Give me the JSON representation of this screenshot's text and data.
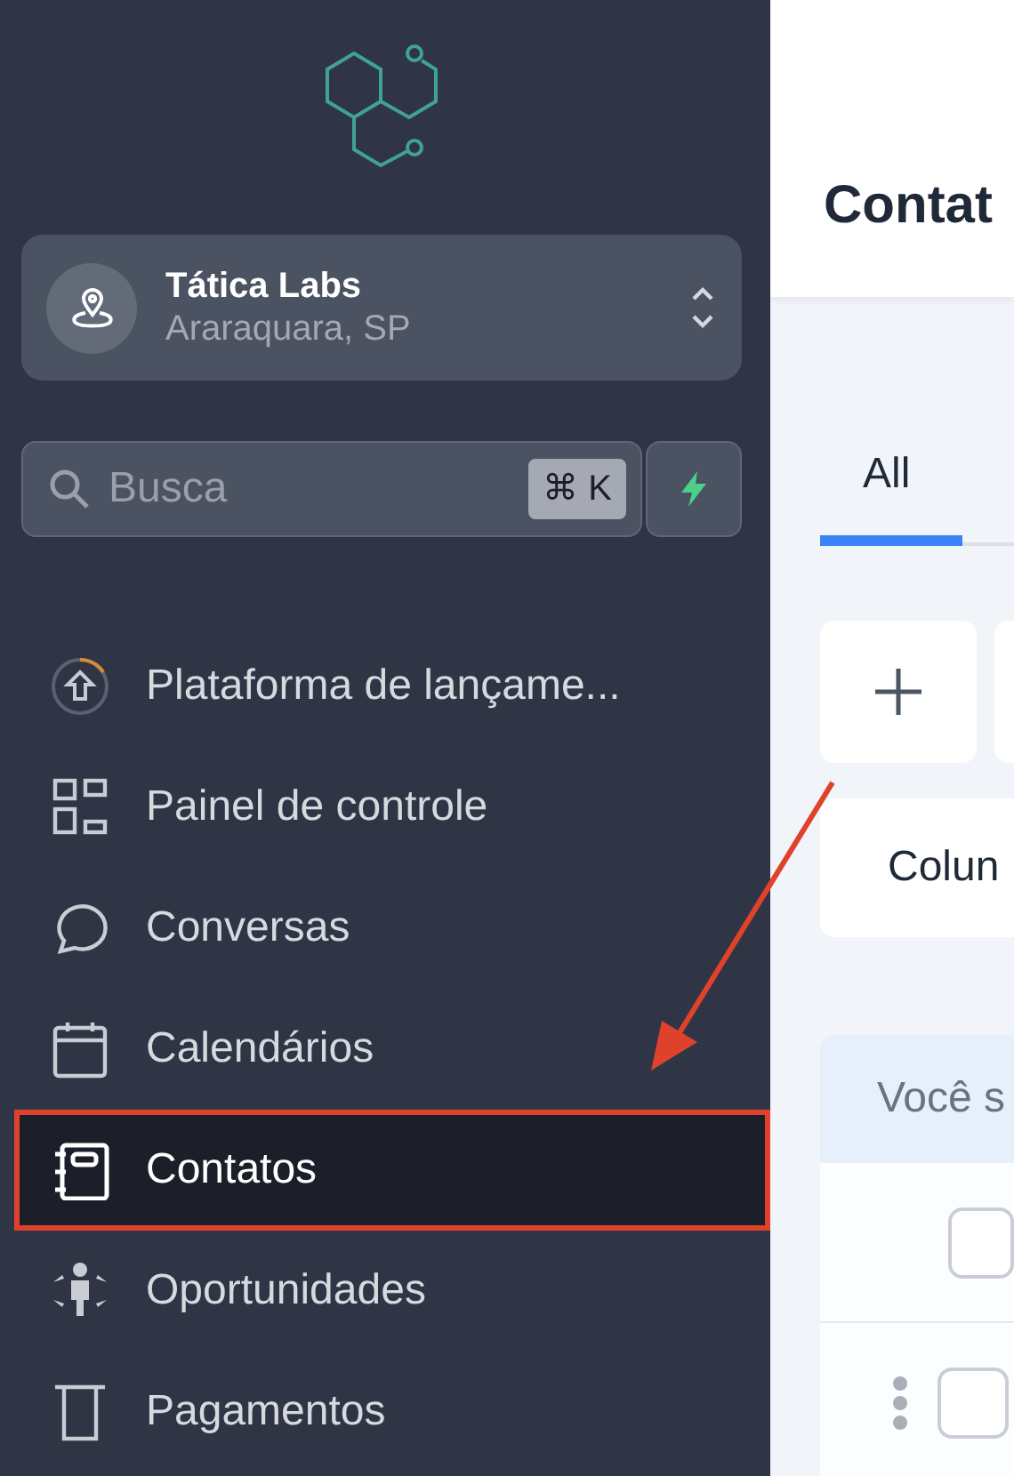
{
  "sidebar": {
    "location": {
      "name": "Tática Labs",
      "city": "Araraquara, SP"
    },
    "search": {
      "placeholder": "Busca",
      "shortcut": "⌘ K"
    },
    "items": [
      {
        "label": "Plataforma de lançame...",
        "selected": false,
        "annotated": false
      },
      {
        "label": "Painel de controle",
        "selected": false,
        "annotated": false
      },
      {
        "label": "Conversas",
        "selected": false,
        "annotated": false
      },
      {
        "label": "Calendários",
        "selected": false,
        "annotated": false
      },
      {
        "label": "Contatos",
        "selected": true,
        "annotated": true
      },
      {
        "label": "Oportunidades",
        "selected": false,
        "annotated": false
      },
      {
        "label": "Pagamentos",
        "selected": false,
        "annotated": false
      }
    ]
  },
  "main": {
    "title": "Contat",
    "tabs": [
      {
        "label": "All",
        "selected": true
      }
    ],
    "columns_button": "Colun",
    "banner": "Você s",
    "rows": [
      {
        "checked": false,
        "menu": false
      },
      {
        "checked": false,
        "menu": true
      }
    ]
  }
}
